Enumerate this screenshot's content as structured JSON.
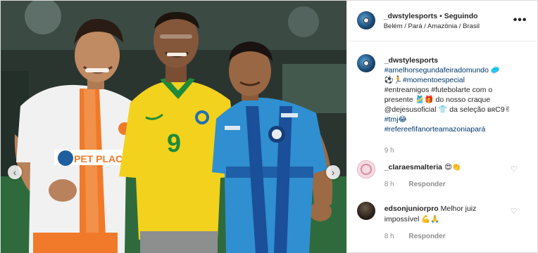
{
  "post": {
    "author": "_dwstylesports",
    "separator": "•",
    "follow_label": "Seguindo",
    "location": "Belém / Pará / Amazônia / Brasil",
    "more_label": "•••",
    "prev_label": "‹",
    "next_label": "›"
  },
  "caption": {
    "author": "_dwstylesports",
    "lines": [
      "#amelhorsegundafeiradomundo 🥏",
      "⚽🏃#momentoespecial",
      "#entreamigos #futebolarte com o",
      "presente 🎽🎁 do nosso craque",
      "@dejesusoficial 👕 da seleção ʙʀC9✌",
      "#tmj😂",
      "#refereefifanorteamazoniapará"
    ],
    "time": "9 h"
  },
  "comments": [
    {
      "user": "_claraesmalteria",
      "text": "😍👏",
      "time": "8 h",
      "reply_label": "Responder",
      "heart": "♡"
    },
    {
      "user": "edsonjuniorpro",
      "text_line1": "Melhor juiz",
      "text_line2": "impossível 💪🙏",
      "time": "8 h",
      "reply_label": "Responder",
      "heart": "♡"
    }
  ],
  "photo": {
    "shirt_number": "9",
    "sponsor_text": "PET PLACE"
  },
  "colors": {
    "link": "#00376b",
    "muted": "#8e8e8e",
    "brazil_yellow": "#f2d21c",
    "brazil_green": "#1f8a3a",
    "blue_kit": "#2f8fd0",
    "orange_stripe": "#f07a2a"
  }
}
